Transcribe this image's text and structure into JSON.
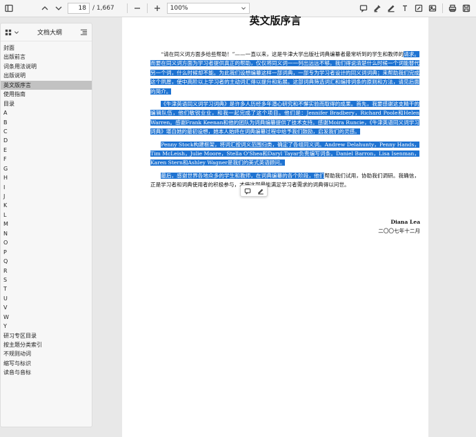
{
  "toolbar": {
    "current_page": "18",
    "total_pages": "/ 1,667",
    "zoom": "100%"
  },
  "sidebar": {
    "title": "文档大纲",
    "items": [
      "封面",
      "出版前言",
      "词条用法说明",
      "出版说明",
      "英文版序言",
      "使用指南",
      "目录",
      "A",
      "B",
      "C",
      "D",
      "E",
      "F",
      "G",
      "H",
      "I",
      "J",
      "K",
      "L",
      "M",
      "N",
      "O",
      "P",
      "Q",
      "R",
      "S",
      "T",
      "U",
      "V",
      "W",
      "Y",
      "研习专区目录",
      "按主题分类索引",
      "不规则动词",
      "缩写与标识",
      "读音与音标"
    ],
    "active_index": 4
  },
  "page": {
    "title": "英文版序言",
    "p1_a": "“请在同义词方面多给些帮助！”——一直以来，这是牛津大学出版社词典编纂者最常听到的学生和教师的",
    "p1_hl": "请求。而要在同义词方面为学习者提供真正的帮助，仅仅将同义词一一列出远远不够。我们得说清楚什么时候一个词能替代另一个词，什么时候却不能。为此我们设想编纂这样一部词典，一部专为学习者设计的同义词词典；来帮助我们完成这个夙愿，使中高阶以上学习者的主动词汇得以提升和拓展。这部词典筛选词汇和编排词条的原则和方法，请见后面的简介。",
    "p2_hl": "《牛津英语同义词学习词典》是许多人历经多年潜心研究和不懈实验而取得的成果。首先，我要感谢这支精干的编辑队伍，他们敏锐业业，和我一起完成了这个项目。他们是：Jennifer Bradbery，Richard Poole和Helen Warren。感谢Frank Keenan和他的团队为词典编纂提供了技术支持。感谢Moira Runcie，《牛津英语同义词学习词典》堪自她的最初设想，她本人始终在词典编纂过程中给予我们鼓励，启发我们的灵感。",
    "p3_hl": "Penny Stock构建框架，将词汇按词义范围归类，确定了各组同义词。Andrew Delahunty，Penny Hands，Tim McLeish，Julie Moore，Stella O'Shea和Daryl Tayar负责编写词条。Daniel Barron，Lisa Isenman，Karen Stern和Ashley Wagner是我们的美式英语顾问。",
    "p4_hl": "最后，感谢世界各地众多的学生和教师，在词典编纂的各个阶段，他们",
    "p4_a": "帮助我们试用，协助我们调研。我确信，正是学习者和词典使用者的积极参与，才使这部最能满足学习者需求的词典得以问世。",
    "signature_name": "Diana Lea",
    "signature_date": "二〇〇七年十二月"
  },
  "icons": {
    "toolbar_left": [
      "sidebar-toggle-icon"
    ],
    "toolbar_right": [
      "comment-icon",
      "highlight-icon",
      "text-icon",
      "draw-icon",
      "image-icon",
      "print-icon",
      "save-icon"
    ]
  }
}
